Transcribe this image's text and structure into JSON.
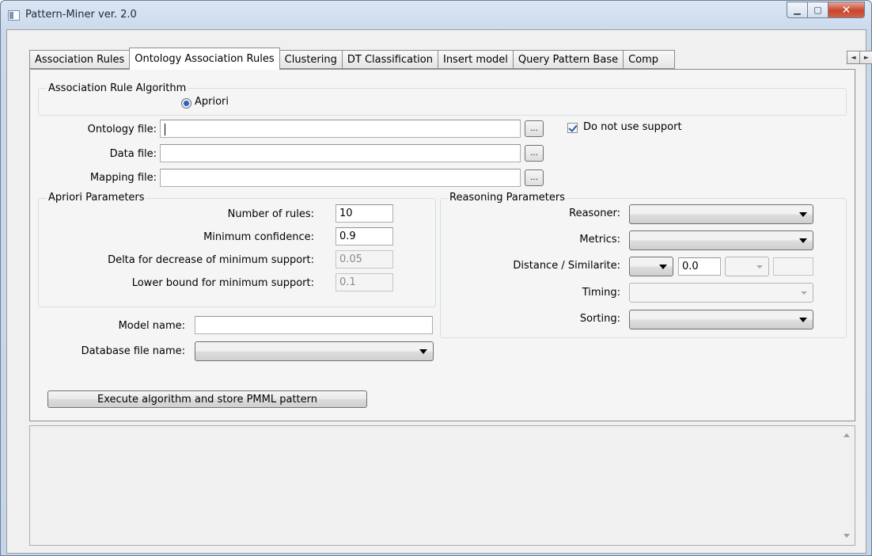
{
  "window": {
    "title": "Pattern-Miner ver. 2.0",
    "min_glyph": "▁",
    "max_glyph": "▢",
    "close_glyph": "✕"
  },
  "tabs": [
    {
      "label": "Association Rules",
      "active": false
    },
    {
      "label": "Ontology Association Rules",
      "active": true
    },
    {
      "label": "Clustering",
      "active": false
    },
    {
      "label": "DT Classification",
      "active": false
    },
    {
      "label": "Insert model",
      "active": false
    },
    {
      "label": "Query Pattern Base",
      "active": false
    },
    {
      "label": "Comp",
      "active": false
    }
  ],
  "tab_scroll": {
    "left": "◄",
    "right": "►"
  },
  "algorithm": {
    "group_title": "Association Rule Algorithm",
    "option": "Apriori",
    "selected": true
  },
  "files": {
    "ontology_label": "Ontology file:",
    "ontology_value": "",
    "data_label": "Data file:",
    "data_value": "",
    "mapping_label": "Mapping file:",
    "mapping_value": "",
    "browse_label": "...",
    "no_support_label": "Do not use support",
    "no_support_checked": true
  },
  "apriori": {
    "group_title": "Apriori Parameters",
    "num_rules_label": "Number of rules:",
    "num_rules": "10",
    "min_conf_label": "Minimum confidence:",
    "min_conf": "0.9",
    "delta_label": "Delta for decrease of minimum support:",
    "delta": "0.05",
    "lower_bound_label": "Lower bound for minimum support:",
    "lower_bound": "0.1"
  },
  "reasoning": {
    "group_title": "Reasoning Parameters",
    "reasoner_label": "Reasoner:",
    "reasoner": "",
    "metrics_label": "Metrics:",
    "metrics": "",
    "distance_label": "Distance / Similarite:",
    "distance_value": "0.0",
    "timing_label": "Timing:",
    "sorting_label": "Sorting:"
  },
  "model": {
    "model_name_label": "Model name:",
    "model_name": "",
    "db_file_label": "Database file name:",
    "db_file": ""
  },
  "execute_label": "Execute algorithm and store PMML pattern",
  "output_text": ""
}
